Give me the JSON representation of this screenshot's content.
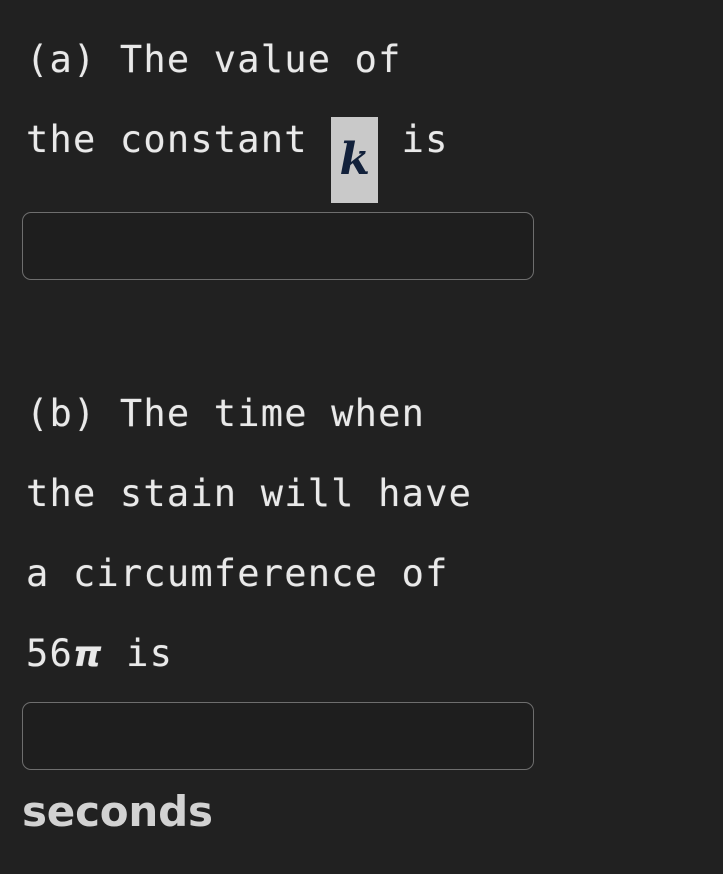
{
  "background_color": "#212121",
  "text_color": "#e9e9e9",
  "input_border_color": "#6e6e6e",
  "math_highlight_color": "#c9c9c9",
  "math_glyph_color": "#12213b",
  "questions": [
    {
      "id": "a",
      "label": "(a)",
      "lines": [
        "(a) The value of",
        "the constant"
      ],
      "line1": "(a) The value of",
      "line2_before_math": "the constant ",
      "math_token": "k",
      "line2_after_math": " is",
      "answer": {
        "value": "",
        "placeholder": ""
      }
    },
    {
      "id": "b",
      "label": "(b)",
      "line1": "(b) The time when",
      "line2": "the stain will have",
      "line3": "a circumference of",
      "line4_before_pi": "56",
      "pi_symbol": "π",
      "line4_after_pi": " is",
      "answer": {
        "value": "",
        "placeholder": ""
      },
      "unit": "seconds"
    }
  ]
}
